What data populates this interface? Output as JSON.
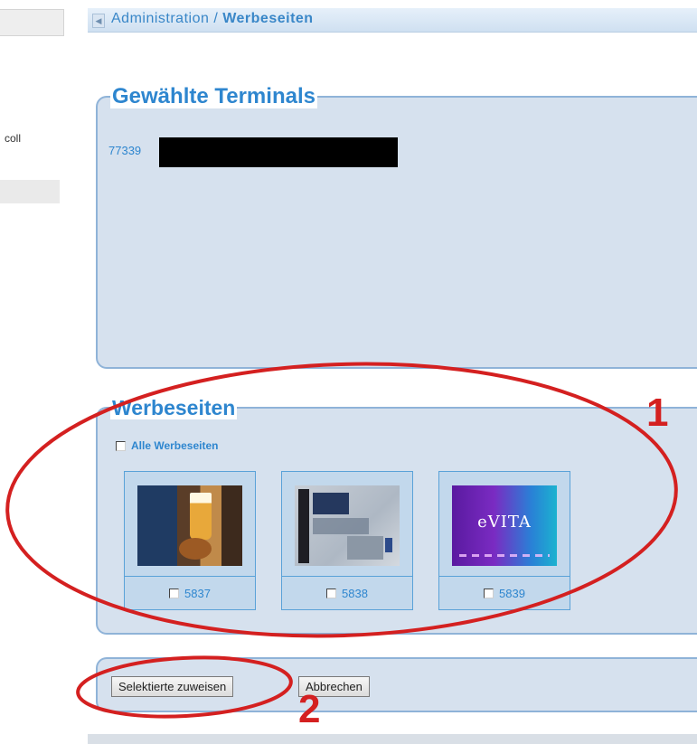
{
  "sidebar": {
    "partial_text": "coll"
  },
  "breadcrumb": {
    "section": "Administration",
    "separator": " / ",
    "page": "Werbeseiten"
  },
  "terminals": {
    "legend": "Gewählte Terminals",
    "selected": [
      {
        "id": "77339",
        "name_redacted": true
      }
    ]
  },
  "werbeseiten": {
    "legend": "Werbeseiten",
    "select_all_label": "Alle Werbeseiten",
    "select_all_checked": false,
    "items": [
      {
        "id": "5837",
        "checked": false
      },
      {
        "id": "5838",
        "checked": false
      },
      {
        "id": "5839",
        "checked": false
      }
    ],
    "thumb3_logo_text": "eVITA"
  },
  "actions": {
    "assign_label": "Selektierte zuweisen",
    "cancel_label": "Abbrechen"
  },
  "annotations": {
    "marker_1": "1",
    "marker_2": "2",
    "color": "#d42020"
  }
}
